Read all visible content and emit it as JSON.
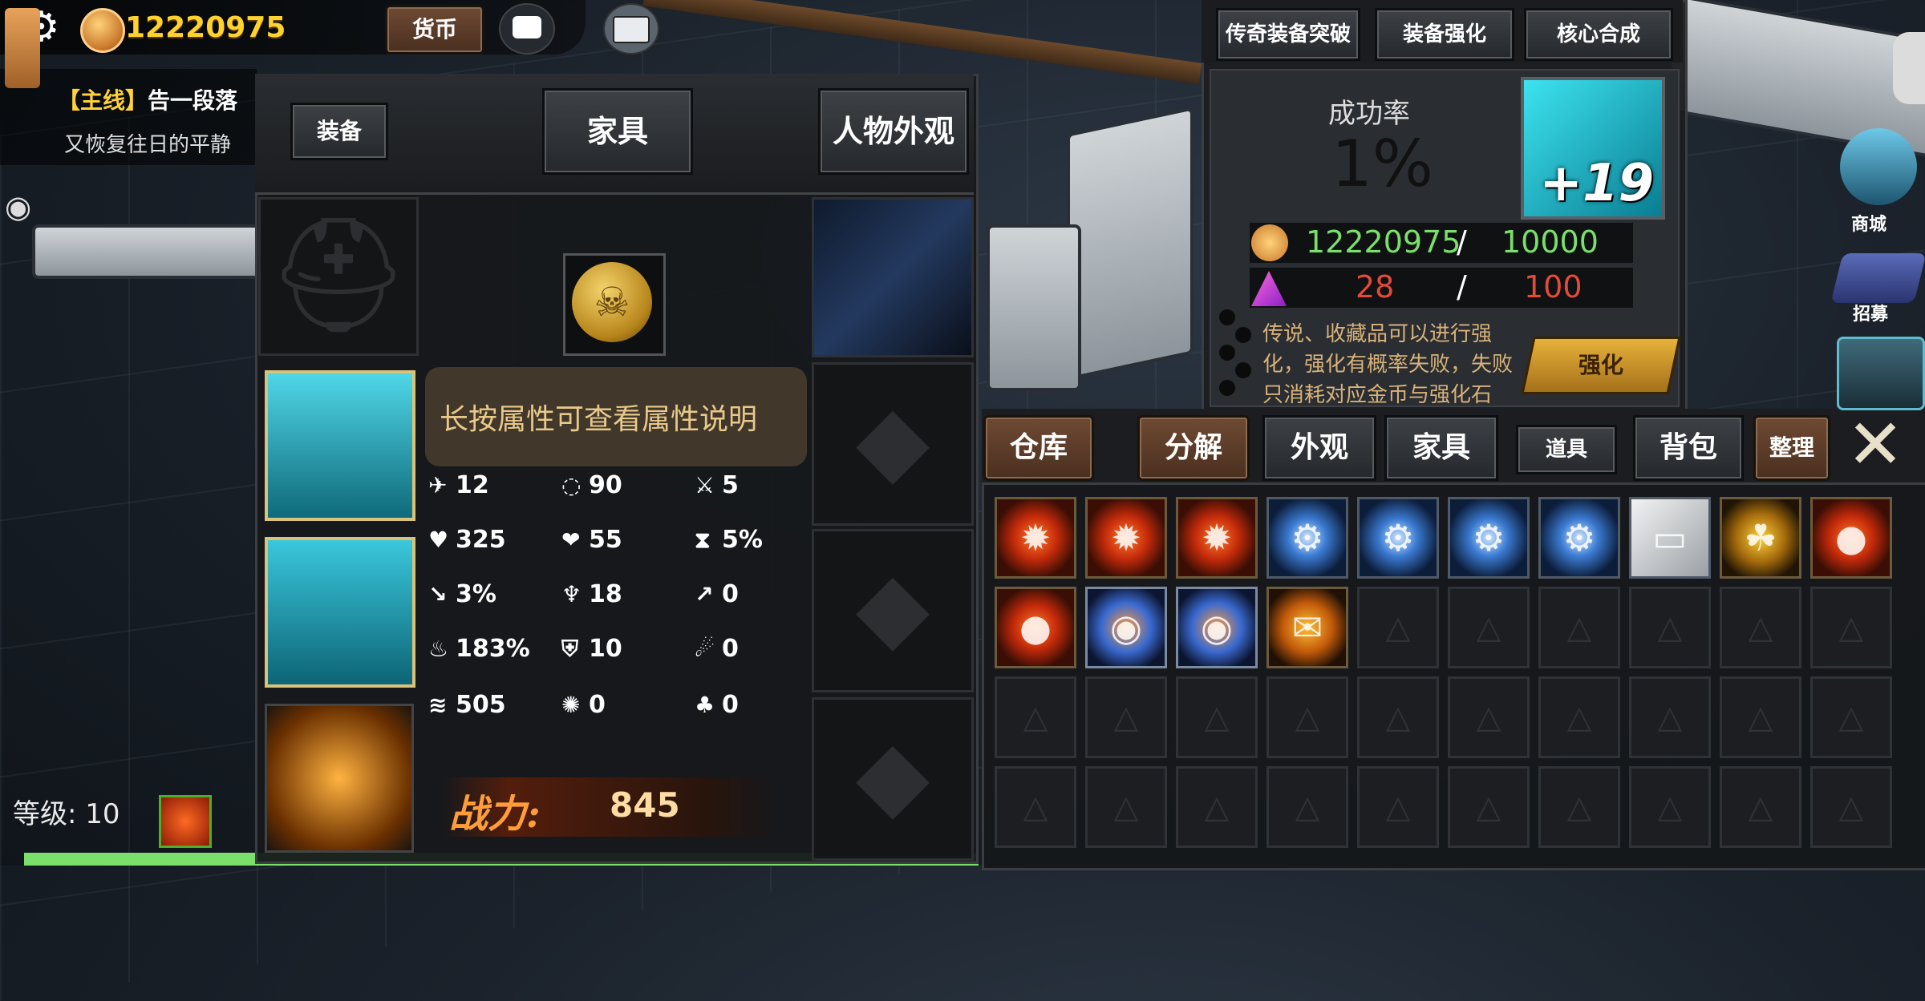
{
  "hud": {
    "gold_amount": "12220975",
    "currency_button": "货币"
  },
  "quest": {
    "tag": "【主线】",
    "title": "告一段落",
    "desc": "又恢复往日的平静"
  },
  "player": {
    "level_label": "等级:",
    "level_value": "10"
  },
  "equipment_panel": {
    "tabs": [
      "装备",
      "家具",
      "人物外观"
    ],
    "tip": "长按属性可查看属性说明",
    "stats": [
      {
        "icon": "attack-speed-icon",
        "glyph": "✈",
        "value": "12"
      },
      {
        "icon": "cooldown-icon",
        "glyph": "◌",
        "value": "90"
      },
      {
        "icon": "sword-icon",
        "glyph": "⚔",
        "value": "5"
      },
      {
        "icon": "health-icon",
        "glyph": "♥",
        "value": "325"
      },
      {
        "icon": "regen-icon",
        "glyph": "❤",
        "value": "55"
      },
      {
        "icon": "hourglass-icon",
        "glyph": "⧗",
        "value": "5%"
      },
      {
        "icon": "crit-icon",
        "glyph": "↘",
        "value": "3%"
      },
      {
        "icon": "wings-icon",
        "glyph": "♆",
        "value": "18"
      },
      {
        "icon": "pierce-icon",
        "glyph": "↗",
        "value": "0"
      },
      {
        "icon": "fire-damage-icon",
        "glyph": "♨",
        "value": "183%"
      },
      {
        "icon": "shield-icon",
        "glyph": "⛨",
        "value": "10"
      },
      {
        "icon": "flame-icon",
        "glyph": "☄",
        "value": "0"
      },
      {
        "icon": "speed-icon",
        "glyph": "≋",
        "value": "505"
      },
      {
        "icon": "palette-icon",
        "glyph": "✺",
        "value": "0"
      },
      {
        "icon": "lifesteal-icon",
        "glyph": "♣",
        "value": "0"
      }
    ],
    "power_label": "战力:",
    "power_value": "845"
  },
  "enhance_panel": {
    "tabs": [
      "传奇装备突破",
      "装备强化",
      "核心合成"
    ],
    "rate_label": "成功率",
    "rate_value": "1%",
    "item_level": "+19",
    "gold_have": "12220975",
    "gold_need": "10000",
    "stone_have": "28",
    "stone_need": "100",
    "separator": "/",
    "desc": "传说、收藏品可以进行强化，强化有概率失败，失败只消耗对应金币与强化石",
    "button": "强化"
  },
  "inventory": {
    "tabs": [
      "仓库",
      "分解",
      "外观",
      "家具",
      "道具",
      "背包",
      "整理"
    ],
    "items": [
      "fire-core",
      "fire-core",
      "fire-core",
      "gear-core",
      "gear-core",
      "gear-core",
      "gear-core",
      "card-item",
      "clover-item",
      "fire-orb",
      "fire-orb",
      "blue-flame-orb",
      "blue-flame-orb",
      "fire-ticket",
      "",
      "",
      "",
      "",
      "",
      "",
      "",
      "",
      "",
      "",
      "",
      "",
      "",
      "",
      "",
      "",
      "",
      "",
      "",
      "",
      "",
      "",
      "",
      "",
      "",
      ""
    ]
  },
  "sidebar": {
    "store_label": "商城",
    "recruit_label": "招募"
  }
}
